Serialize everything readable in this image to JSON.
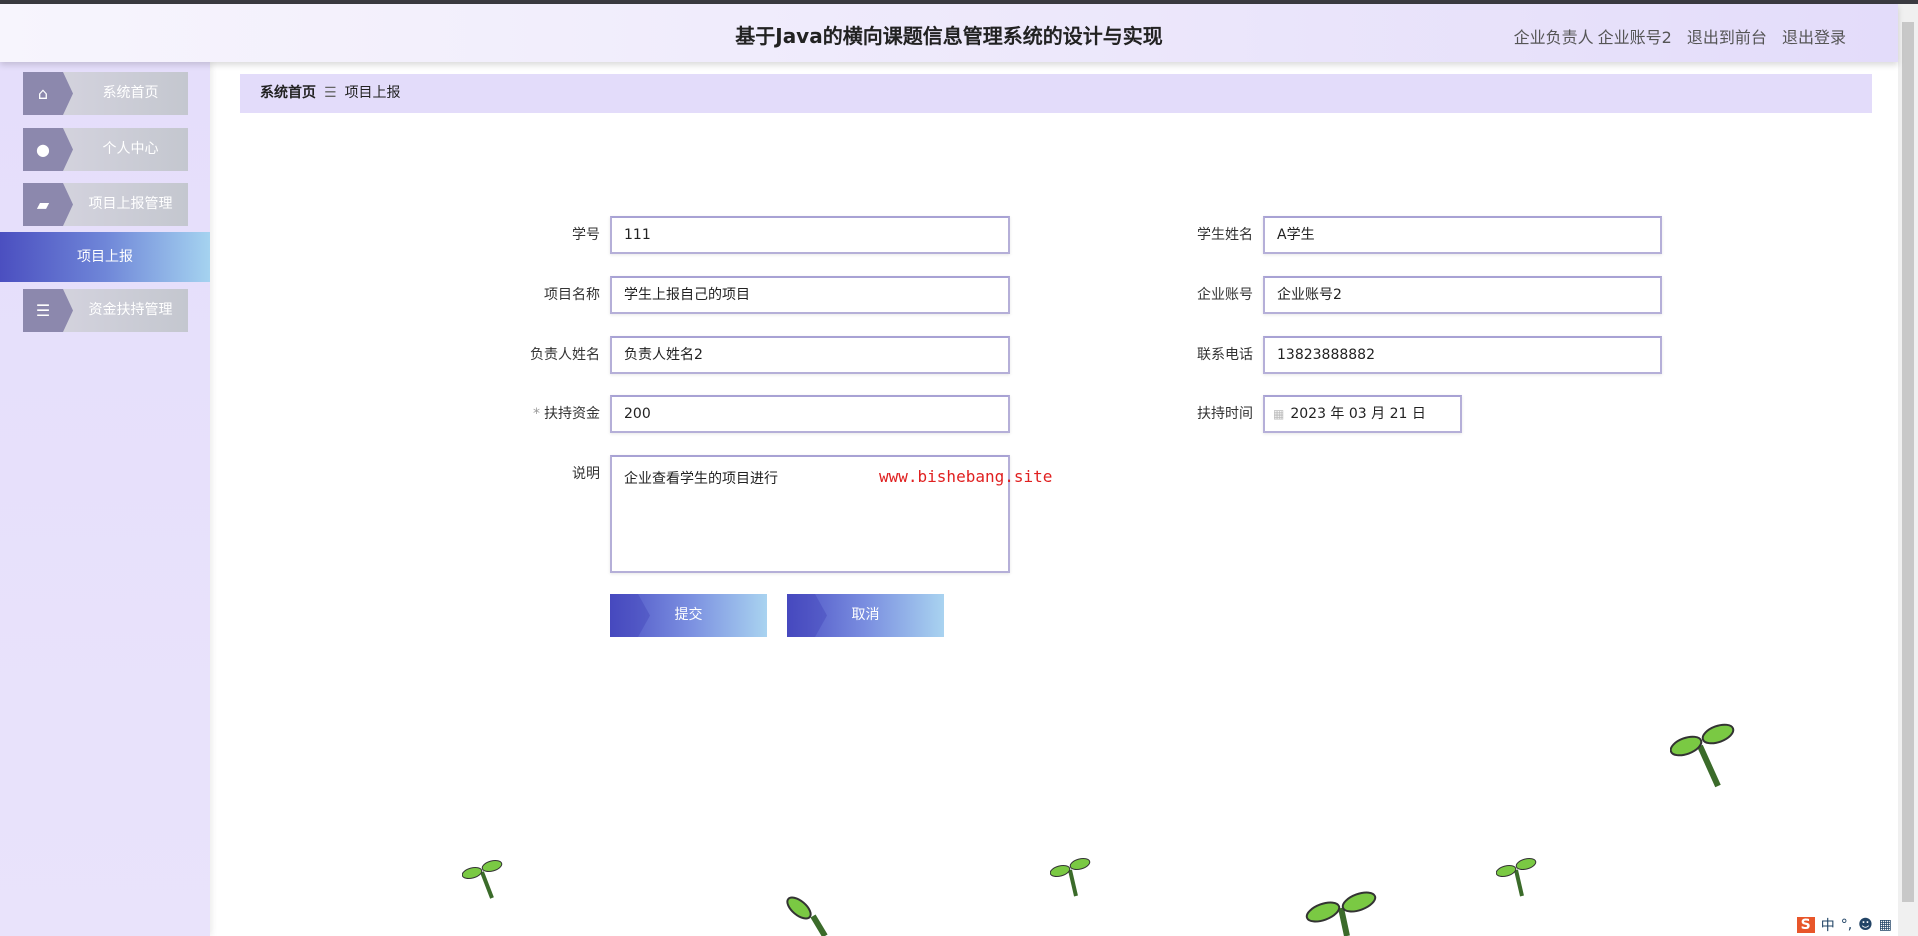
{
  "header": {
    "title": "基于Java的横向课题信息管理系统的设计与实现",
    "role": "企业负责人",
    "account": "企业账号2",
    "to_front": "退出到前台",
    "logout": "退出登录"
  },
  "sidebar": {
    "items": [
      {
        "label": "系统首页",
        "icon": "home-icon"
      },
      {
        "label": "个人中心",
        "icon": "user-icon"
      },
      {
        "label": "项目上报管理",
        "icon": "wallet-icon"
      },
      {
        "label": "项目上报",
        "active": true
      },
      {
        "label": "资金扶持管理",
        "icon": "list-icon"
      }
    ]
  },
  "breadcrumb": {
    "home": "系统首页",
    "sep": "☰",
    "current": "项目上报"
  },
  "form": {
    "student_no": {
      "label": "学号",
      "value": "111"
    },
    "student_name": {
      "label": "学生姓名",
      "value": "A学生"
    },
    "project_name": {
      "label": "项目名称",
      "value": "学生上报自己的项目"
    },
    "company_account": {
      "label": "企业账号",
      "value": "企业账号2"
    },
    "leader_name": {
      "label": "负责人姓名",
      "value": "负责人姓名2"
    },
    "phone": {
      "label": "联系电话",
      "value": "13823888882"
    },
    "funds": {
      "label": "扶持资金",
      "required": "*",
      "value": "200"
    },
    "support_time": {
      "label": "扶持时间",
      "value": "2023 年 03 月 21 日"
    },
    "description": {
      "label": "说明",
      "value": "企业查看学生的项目进行"
    },
    "submit": "提交",
    "cancel": "取消"
  },
  "watermark": "www.bishebang.site",
  "ime": {
    "brand": "S",
    "lang": "中",
    "punct": "°,"
  }
}
